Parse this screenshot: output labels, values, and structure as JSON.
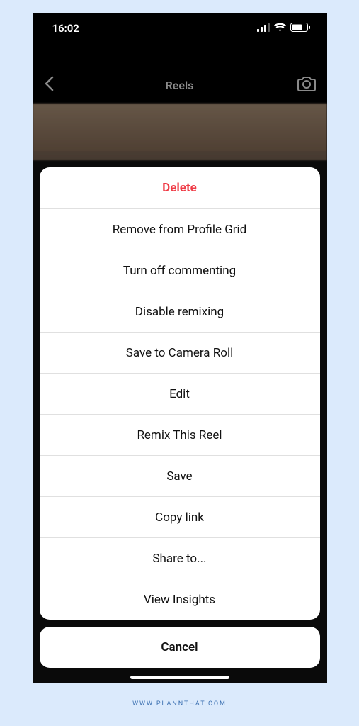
{
  "status": {
    "time": "16:02"
  },
  "nav": {
    "title": "Reels"
  },
  "sheet": {
    "items": [
      {
        "label": "Delete",
        "destructive": true
      },
      {
        "label": "Remove from Profile Grid",
        "destructive": false
      },
      {
        "label": "Turn off commenting",
        "destructive": false
      },
      {
        "label": "Disable remixing",
        "destructive": false
      },
      {
        "label": "Save to Camera Roll",
        "destructive": false
      },
      {
        "label": "Edit",
        "destructive": false
      },
      {
        "label": "Remix This Reel",
        "destructive": false
      },
      {
        "label": "Save",
        "destructive": false
      },
      {
        "label": "Copy link",
        "destructive": false
      },
      {
        "label": "Share to...",
        "destructive": false
      },
      {
        "label": "View Insights",
        "destructive": false
      }
    ],
    "cancel": "Cancel"
  },
  "footer": {
    "link": "WWW.PLANNTHAT.COM"
  }
}
